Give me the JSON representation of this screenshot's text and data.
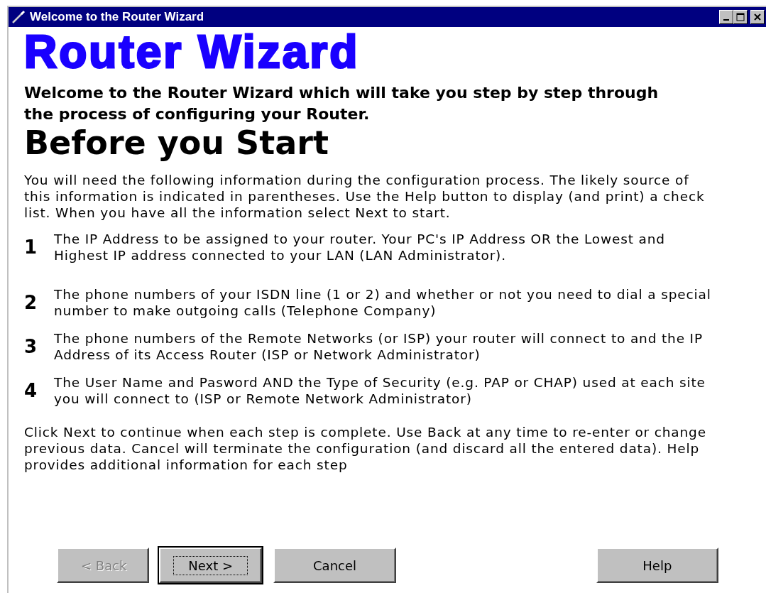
{
  "window": {
    "title": "Welcome to the Router Wizard"
  },
  "heading": "Router Wizard",
  "intro": "Welcome to the Router Wizard which will take you step by step through the process of configuring your Router.",
  "section_title": "Before you Start",
  "description": "You will need the following information during the configuration process. The likely source of this information is indicated in parentheses. Use the Help button to display (and print) a check list. When you have all the information select Next to start.",
  "steps": [
    {
      "number": "1",
      "text": "The IP Address to be assigned to your router. Your PC's IP Address OR the Lowest and Highest IP address connected to your LAN (LAN Administrator)."
    },
    {
      "number": "2",
      "text": "The phone numbers of your ISDN line (1 or 2) and whether or not you need to dial a special number to make outgoing calls (Telephone Company)"
    },
    {
      "number": "3",
      "text": "The phone numbers of the Remote Networks (or ISP) your router will connect to and the IP Address of its Access Router (ISP or Network Administrator)"
    },
    {
      "number": "4",
      "text": "The User Name and Pasword AND the Type of Security (e.g. PAP or CHAP) used at each site you will connect to (ISP or Remote Network Administrator)"
    }
  ],
  "footer_note": "Click Next to continue when each step is complete. Use Back at any time to re-enter or change previous data. Cancel will terminate the configuration (and discard all the entered data). Help provides additional information for each step",
  "buttons": [
    {
      "label": "< Back",
      "disabled": true,
      "default": false
    },
    {
      "label": "Next >",
      "disabled": false,
      "default": true
    },
    {
      "label": "Cancel",
      "disabled": false,
      "default": false
    },
    {
      "label": "Help",
      "disabled": false,
      "default": false
    }
  ]
}
